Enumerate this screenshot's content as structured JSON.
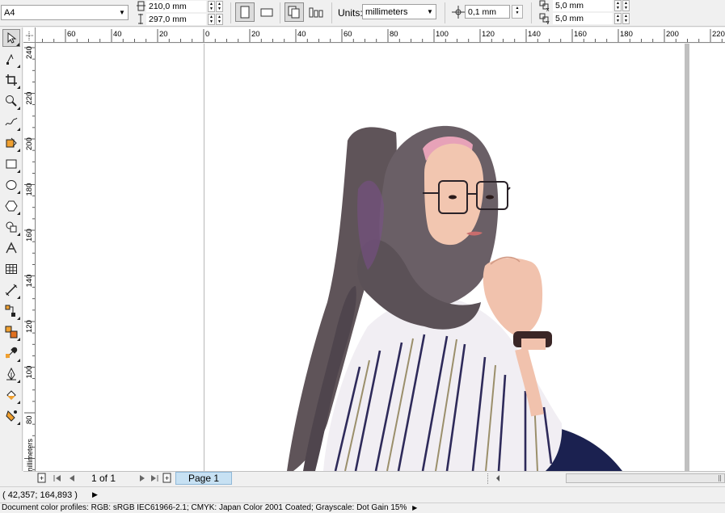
{
  "propbar": {
    "paper_size": "A4",
    "width_value": "210,0 mm",
    "height_value": "297,0 mm",
    "units_label": "Units:",
    "units_value": "millimeters",
    "nudge_value": "0,1 mm",
    "dup_x_value": "5,0 mm",
    "dup_y_value": "5,0 mm"
  },
  "rulers": {
    "h_labels": [
      "60",
      "40",
      "20",
      "0",
      "20",
      "40",
      "60",
      "80",
      "100",
      "120",
      "140",
      "160",
      "180",
      "200",
      "220"
    ],
    "v_labels": [
      "240",
      "220",
      "200",
      "180",
      "160",
      "140",
      "120",
      "100",
      "80"
    ],
    "units": "millimeters"
  },
  "toolbox": {
    "icons": [
      "pick-tool-icon",
      "shape-tool-icon",
      "crop-tool-icon",
      "zoom-tool-icon",
      "freehand-tool-icon",
      "smart-fill-tool-icon",
      "rectangle-tool-icon",
      "ellipse-tool-icon",
      "polygon-tool-icon",
      "basic-shapes-tool-icon",
      "text-tool-icon",
      "table-tool-icon",
      "dimension-tool-icon",
      "connector-tool-icon",
      "blend-tool-icon",
      "eyedropper-tool-icon",
      "outline-pen-tool-icon",
      "fill-tool-icon",
      "interactive-fill-tool-icon"
    ]
  },
  "navigation": {
    "page_count": "1 of 1",
    "page_tab": "Page 1"
  },
  "status": {
    "cursor_coords": "( 42,357; 164,893 )",
    "color_profiles": "Document color profiles: RGB: sRGB IEC61966-2.1; CMYK: Japan Color 2001 Coated; Grayscale: Dot Gain 15%"
  }
}
